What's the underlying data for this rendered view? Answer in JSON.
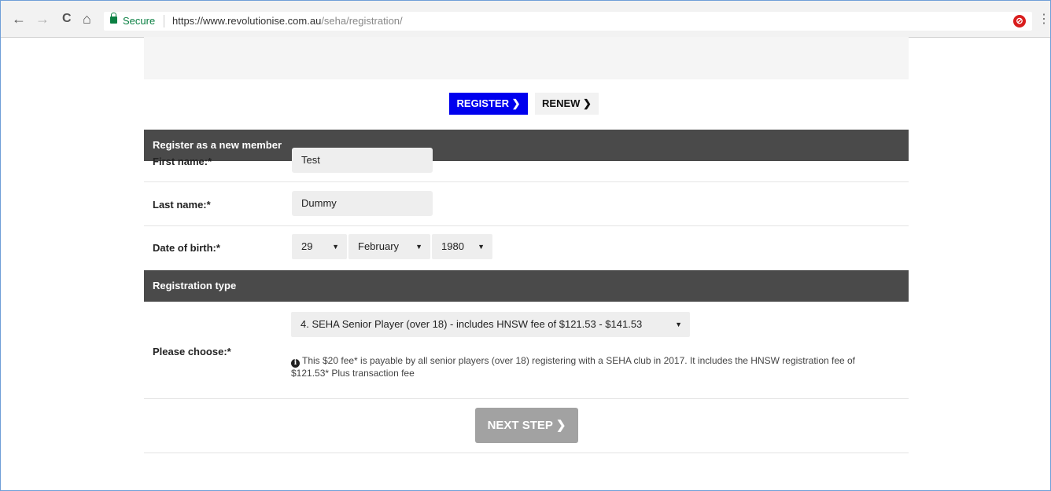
{
  "browser": {
    "back_icon": "←",
    "forward_icon": "→",
    "reload_icon": "C",
    "home_icon": "⌂",
    "secure_label": "Secure",
    "url_host": "https://www.revolutionise.com.au",
    "url_path": "/seha/registration/",
    "bookmark_icon": "☆",
    "extension_icon": "⊘",
    "menu_icon": "⋮"
  },
  "actions": {
    "register_label": "REGISTER ❯",
    "renew_label": "RENEW ❯"
  },
  "member_section": {
    "title": "Register as a new member",
    "first_name_label": "First name:*",
    "first_name_value": "Test",
    "last_name_label": "Last name:*",
    "last_name_value": "Dummy",
    "dob_label": "Date of birth:*",
    "dob_day": "29",
    "dob_month": "February",
    "dob_year": "1980",
    "select_caret": "▼"
  },
  "registration_section": {
    "title": "Registration type",
    "choose_label": "Please choose:*",
    "selected_option": "4. SEHA Senior Player (over 18) - includes HNSW fee of $121.53 - $141.53",
    "info_icon": "i",
    "info_text": "This $20 fee* is payable by all senior players (over 18) registering with a SEHA club in 2017. It includes the HNSW registration fee of $121.53* Plus transaction fee"
  },
  "footer": {
    "next_label": "NEXT STEP ❯"
  },
  "colors": {
    "register_button": "#0000ee",
    "section_header": "#4a4a4a",
    "secure_green": "#0b8043",
    "next_button": "#a2a2a2"
  }
}
